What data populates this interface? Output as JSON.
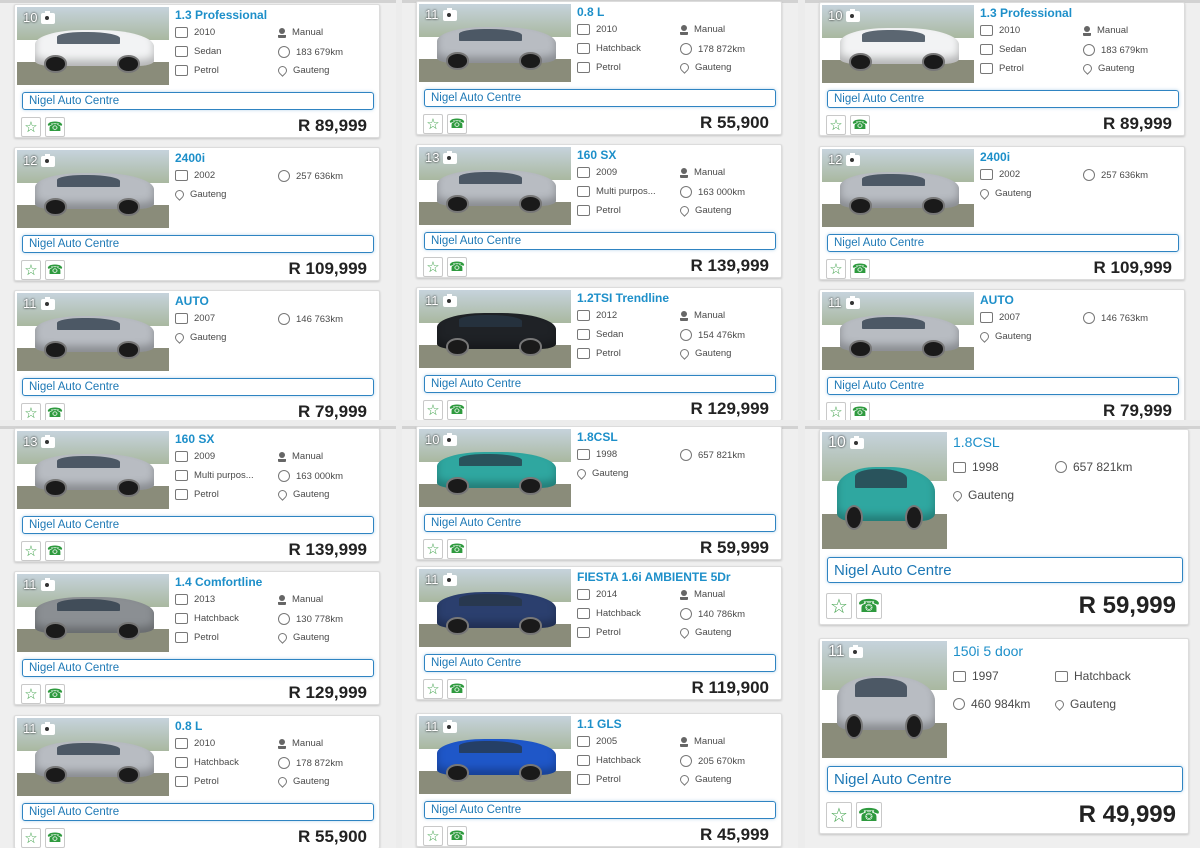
{
  "labels": {
    "dealer": "Nigel Auto Centre"
  },
  "icons": {
    "camera": "camera-icon",
    "star": "star-icon",
    "phone": "phone-icon",
    "year": "calendar-icon",
    "transmission": "gear-lever-icon",
    "body": "car-body-icon",
    "mileage": "odometer-icon",
    "fuel": "fuel-pump-icon",
    "location": "map-pin-icon"
  },
  "colors": {
    "title": "#1d8fc9",
    "dealer_border": "#2f84c2",
    "action_green": "#3fa14a",
    "price": "#222222"
  },
  "listings": [
    {
      "photo_count": "10",
      "title": "1.3 Professional",
      "year": "2010",
      "transmission": "Manual",
      "body": "Sedan",
      "mileage": "183 679km",
      "fuel": "Petrol",
      "location": "Gauteng",
      "dealer": "Nigel Auto Centre",
      "price": "R 89,999",
      "car_color": "white"
    },
    {
      "photo_count": "12",
      "title": "2400i",
      "year": "2002",
      "mileage": "257 636km",
      "location": "Gauteng",
      "dealer": "Nigel Auto Centre",
      "price": "R 109,999",
      "car_color": "silver"
    },
    {
      "photo_count": "11",
      "title": "AUTO",
      "year": "2007",
      "mileage": "146 763km",
      "location": "Gauteng",
      "dealer": "Nigel Auto Centre",
      "price": "R 79,999",
      "car_color": "silver"
    },
    {
      "photo_count": "11",
      "title": "0.8 L",
      "year": "2010",
      "transmission": "Manual",
      "body": "Hatchback",
      "mileage": "178 872km",
      "fuel": "Petrol",
      "location": "Gauteng",
      "dealer": "Nigel Auto Centre",
      "price": "R 55,900",
      "car_color": "silver"
    },
    {
      "photo_count": "13",
      "title": "160 SX",
      "year": "2009",
      "transmission": "Manual",
      "body": "Multi purpos...",
      "mileage": "163 000km",
      "fuel": "Petrol",
      "location": "Gauteng",
      "dealer": "Nigel Auto Centre",
      "price": "R 139,999",
      "car_color": "silver"
    },
    {
      "photo_count": "11",
      "title": "1.2TSI Trendline",
      "year": "2012",
      "transmission": "Manual",
      "body": "Sedan",
      "mileage": "154 476km",
      "fuel": "Petrol",
      "location": "Gauteng",
      "dealer": "Nigel Auto Centre",
      "price": "R 129,999",
      "car_color": "black"
    },
    {
      "photo_count": "10",
      "title": "1.8CSL",
      "year": "1998",
      "mileage": "657 821km",
      "location": "Gauteng",
      "dealer": "Nigel Auto Centre",
      "price": "R 59,999",
      "car_color": "teal"
    },
    {
      "photo_count": "11",
      "title": "1.4 Comfortline",
      "year": "2013",
      "transmission": "Manual",
      "body": "Hatchback",
      "mileage": "130 778km",
      "fuel": "Petrol",
      "location": "Gauteng",
      "dealer": "Nigel Auto Centre",
      "price": "R 129,999",
      "car_color": "grey"
    },
    {
      "photo_count": "11",
      "title": "FIESTA 1.6i AMBIENTE 5Dr",
      "year": "2014",
      "transmission": "Manual",
      "body": "Hatchback",
      "mileage": "140 786km",
      "fuel": "Petrol",
      "location": "Gauteng",
      "dealer": "Nigel Auto Centre",
      "price": "R 119,900",
      "car_color": "navy"
    },
    {
      "photo_count": "11",
      "title": "1.1 GLS",
      "year": "2005",
      "transmission": "Manual",
      "body": "Hatchback",
      "mileage": "205 670km",
      "fuel": "Petrol",
      "location": "Gauteng",
      "dealer": "Nigel Auto Centre",
      "price": "R 45,999",
      "car_color": "blue"
    },
    {
      "photo_count": "11",
      "title": "150i 5 door",
      "year": "1997",
      "body": "Hatchback",
      "mileage": "460 984km",
      "location": "Gauteng",
      "dealer": "Nigel Auto Centre",
      "price": "R 49,999",
      "car_color": "silver"
    }
  ]
}
